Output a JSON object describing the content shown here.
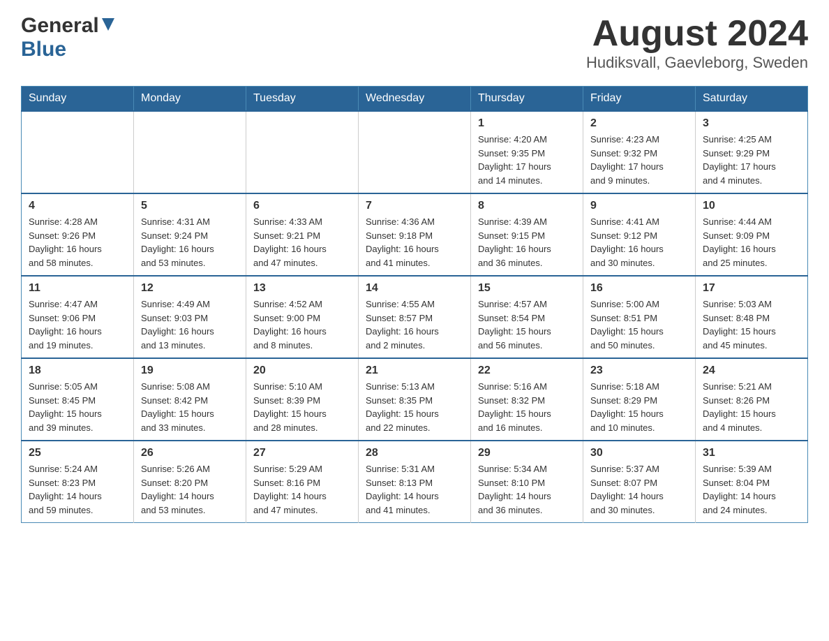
{
  "header": {
    "logo": {
      "general": "General",
      "blue": "Blue",
      "triangle": "▼"
    },
    "title": "August 2024",
    "subtitle": "Hudiksvall, Gaevleborg, Sweden"
  },
  "days_of_week": [
    "Sunday",
    "Monday",
    "Tuesday",
    "Wednesday",
    "Thursday",
    "Friday",
    "Saturday"
  ],
  "weeks": [
    {
      "days": [
        {
          "num": "",
          "info": ""
        },
        {
          "num": "",
          "info": ""
        },
        {
          "num": "",
          "info": ""
        },
        {
          "num": "",
          "info": ""
        },
        {
          "num": "1",
          "info": "Sunrise: 4:20 AM\nSunset: 9:35 PM\nDaylight: 17 hours\nand 14 minutes."
        },
        {
          "num": "2",
          "info": "Sunrise: 4:23 AM\nSunset: 9:32 PM\nDaylight: 17 hours\nand 9 minutes."
        },
        {
          "num": "3",
          "info": "Sunrise: 4:25 AM\nSunset: 9:29 PM\nDaylight: 17 hours\nand 4 minutes."
        }
      ]
    },
    {
      "days": [
        {
          "num": "4",
          "info": "Sunrise: 4:28 AM\nSunset: 9:26 PM\nDaylight: 16 hours\nand 58 minutes."
        },
        {
          "num": "5",
          "info": "Sunrise: 4:31 AM\nSunset: 9:24 PM\nDaylight: 16 hours\nand 53 minutes."
        },
        {
          "num": "6",
          "info": "Sunrise: 4:33 AM\nSunset: 9:21 PM\nDaylight: 16 hours\nand 47 minutes."
        },
        {
          "num": "7",
          "info": "Sunrise: 4:36 AM\nSunset: 9:18 PM\nDaylight: 16 hours\nand 41 minutes."
        },
        {
          "num": "8",
          "info": "Sunrise: 4:39 AM\nSunset: 9:15 PM\nDaylight: 16 hours\nand 36 minutes."
        },
        {
          "num": "9",
          "info": "Sunrise: 4:41 AM\nSunset: 9:12 PM\nDaylight: 16 hours\nand 30 minutes."
        },
        {
          "num": "10",
          "info": "Sunrise: 4:44 AM\nSunset: 9:09 PM\nDaylight: 16 hours\nand 25 minutes."
        }
      ]
    },
    {
      "days": [
        {
          "num": "11",
          "info": "Sunrise: 4:47 AM\nSunset: 9:06 PM\nDaylight: 16 hours\nand 19 minutes."
        },
        {
          "num": "12",
          "info": "Sunrise: 4:49 AM\nSunset: 9:03 PM\nDaylight: 16 hours\nand 13 minutes."
        },
        {
          "num": "13",
          "info": "Sunrise: 4:52 AM\nSunset: 9:00 PM\nDaylight: 16 hours\nand 8 minutes."
        },
        {
          "num": "14",
          "info": "Sunrise: 4:55 AM\nSunset: 8:57 PM\nDaylight: 16 hours\nand 2 minutes."
        },
        {
          "num": "15",
          "info": "Sunrise: 4:57 AM\nSunset: 8:54 PM\nDaylight: 15 hours\nand 56 minutes."
        },
        {
          "num": "16",
          "info": "Sunrise: 5:00 AM\nSunset: 8:51 PM\nDaylight: 15 hours\nand 50 minutes."
        },
        {
          "num": "17",
          "info": "Sunrise: 5:03 AM\nSunset: 8:48 PM\nDaylight: 15 hours\nand 45 minutes."
        }
      ]
    },
    {
      "days": [
        {
          "num": "18",
          "info": "Sunrise: 5:05 AM\nSunset: 8:45 PM\nDaylight: 15 hours\nand 39 minutes."
        },
        {
          "num": "19",
          "info": "Sunrise: 5:08 AM\nSunset: 8:42 PM\nDaylight: 15 hours\nand 33 minutes."
        },
        {
          "num": "20",
          "info": "Sunrise: 5:10 AM\nSunset: 8:39 PM\nDaylight: 15 hours\nand 28 minutes."
        },
        {
          "num": "21",
          "info": "Sunrise: 5:13 AM\nSunset: 8:35 PM\nDaylight: 15 hours\nand 22 minutes."
        },
        {
          "num": "22",
          "info": "Sunrise: 5:16 AM\nSunset: 8:32 PM\nDaylight: 15 hours\nand 16 minutes."
        },
        {
          "num": "23",
          "info": "Sunrise: 5:18 AM\nSunset: 8:29 PM\nDaylight: 15 hours\nand 10 minutes."
        },
        {
          "num": "24",
          "info": "Sunrise: 5:21 AM\nSunset: 8:26 PM\nDaylight: 15 hours\nand 4 minutes."
        }
      ]
    },
    {
      "days": [
        {
          "num": "25",
          "info": "Sunrise: 5:24 AM\nSunset: 8:23 PM\nDaylight: 14 hours\nand 59 minutes."
        },
        {
          "num": "26",
          "info": "Sunrise: 5:26 AM\nSunset: 8:20 PM\nDaylight: 14 hours\nand 53 minutes."
        },
        {
          "num": "27",
          "info": "Sunrise: 5:29 AM\nSunset: 8:16 PM\nDaylight: 14 hours\nand 47 minutes."
        },
        {
          "num": "28",
          "info": "Sunrise: 5:31 AM\nSunset: 8:13 PM\nDaylight: 14 hours\nand 41 minutes."
        },
        {
          "num": "29",
          "info": "Sunrise: 5:34 AM\nSunset: 8:10 PM\nDaylight: 14 hours\nand 36 minutes."
        },
        {
          "num": "30",
          "info": "Sunrise: 5:37 AM\nSunset: 8:07 PM\nDaylight: 14 hours\nand 30 minutes."
        },
        {
          "num": "31",
          "info": "Sunrise: 5:39 AM\nSunset: 8:04 PM\nDaylight: 14 hours\nand 24 minutes."
        }
      ]
    }
  ]
}
